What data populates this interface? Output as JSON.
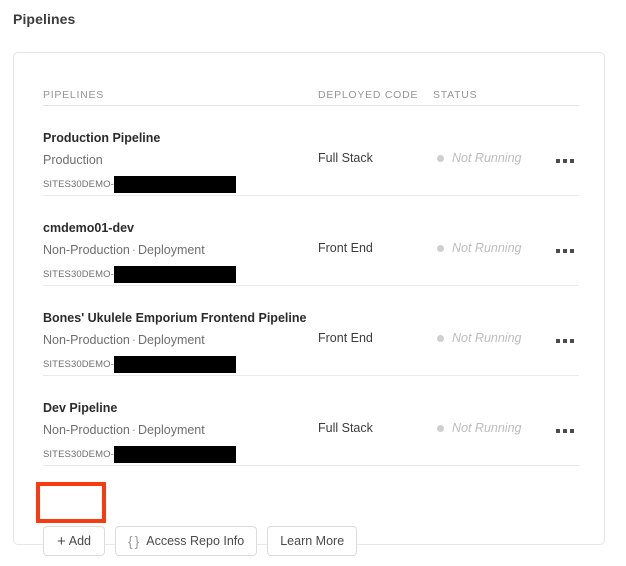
{
  "page": {
    "title": "Pipelines"
  },
  "table": {
    "headers": {
      "pipelines": "PIPELINES",
      "deployed_code": "DEPLOYED CODE",
      "status": "STATUS"
    },
    "rows": [
      {
        "name": "Production Pipeline",
        "environment": "Production",
        "type": "",
        "repo_prefix": "SITES30DEMO-",
        "repo_redacted": true,
        "deployed_code": "Full Stack",
        "status": "Not Running",
        "status_color": "#cfcfcf",
        "menu_icon": "ellipsis-icon"
      },
      {
        "name": "cmdemo01-dev",
        "environment": "Non-Production",
        "type": "Deployment",
        "repo_prefix": "SITES30DEMO-",
        "repo_redacted": true,
        "deployed_code": "Front End",
        "status": "Not Running",
        "status_color": "#cfcfcf",
        "menu_icon": "ellipsis-icon"
      },
      {
        "name": "Bones' Ukulele Emporium Frontend Pipeline",
        "environment": "Non-Production",
        "type": "Deployment",
        "repo_prefix": "SITES30DEMO-",
        "repo_redacted": true,
        "deployed_code": "Front End",
        "status": "Not Running",
        "status_color": "#cfcfcf",
        "menu_icon": "ellipsis-icon"
      },
      {
        "name": "Dev Pipeline",
        "environment": "Non-Production",
        "type": "Deployment",
        "repo_prefix": "SITES30DEMO-",
        "repo_redacted": true,
        "deployed_code": "Full Stack",
        "status": "Not Running",
        "status_color": "#cfcfcf",
        "menu_icon": "ellipsis-icon"
      }
    ],
    "separator": "·"
  },
  "actions": {
    "add_label": "Add",
    "add_icon": "plus-icon",
    "repo_label": "Access Repo Info",
    "repo_icon": "curly-braces-icon",
    "learn_label": "Learn More"
  },
  "annotation": {
    "highlight_color": "#f93b11",
    "highlight_target": "add-button"
  }
}
